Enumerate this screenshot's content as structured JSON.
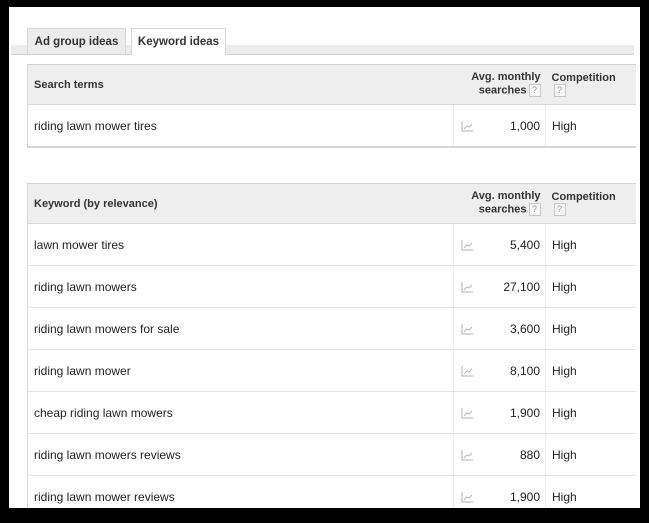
{
  "tabs": [
    {
      "label": "Ad group ideas",
      "active": false
    },
    {
      "label": "Keyword ideas",
      "active": true
    }
  ],
  "search_terms_table": {
    "headers": {
      "term": "Search terms",
      "avg_monthly_line1": "Avg. monthly",
      "avg_monthly_line2": "searches",
      "competition": "Competition",
      "help_glyph": "?"
    },
    "rows": [
      {
        "keyword": "riding lawn mower tires",
        "trend_icon": "line-chart-icon",
        "avg_monthly_searches": "1,000",
        "competition": "High"
      }
    ]
  },
  "keyword_ideas_table": {
    "headers": {
      "term": "Keyword (by relevance)",
      "avg_monthly_line1": "Avg. monthly",
      "avg_monthly_line2": "searches",
      "competition": "Competition",
      "help_glyph": "?"
    },
    "rows": [
      {
        "keyword": "lawn mower tires",
        "trend_icon": "line-chart-icon",
        "avg_monthly_searches": "5,400",
        "competition": "High"
      },
      {
        "keyword": "riding lawn mowers",
        "trend_icon": "line-chart-icon",
        "avg_monthly_searches": "27,100",
        "competition": "High"
      },
      {
        "keyword": "riding lawn mowers for sale",
        "trend_icon": "line-chart-icon",
        "avg_monthly_searches": "3,600",
        "competition": "High"
      },
      {
        "keyword": "riding lawn mower",
        "trend_icon": "line-chart-icon",
        "avg_monthly_searches": "8,100",
        "competition": "High"
      },
      {
        "keyword": "cheap riding lawn mowers",
        "trend_icon": "line-chart-icon",
        "avg_monthly_searches": "1,900",
        "competition": "High"
      },
      {
        "keyword": "riding lawn mowers reviews",
        "trend_icon": "line-chart-icon",
        "avg_monthly_searches": "880",
        "competition": "High"
      },
      {
        "keyword": "riding lawn mower reviews",
        "trend_icon": "line-chart-icon",
        "avg_monthly_searches": "1,900",
        "competition": "High"
      }
    ]
  },
  "colors": {
    "header_bg": "#eeeeee",
    "frame": "#000000",
    "text": "#222222",
    "icon_gray": "#aaaaaa"
  }
}
